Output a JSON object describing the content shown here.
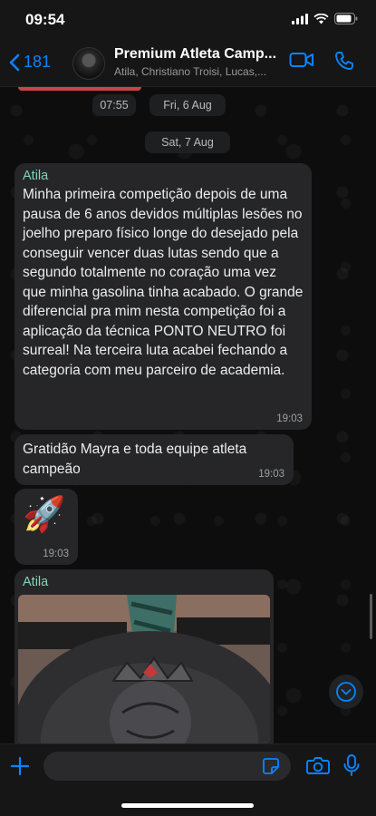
{
  "status_bar": {
    "time": "09:54"
  },
  "header": {
    "back_count": "181",
    "title": "Premium Atleta Camp...",
    "subtitle": "Atila, Christiano Troisi, Lucas,..."
  },
  "top_message": {
    "time": "07:55"
  },
  "date_separators": [
    "Fri, 6 Aug",
    "Sat, 7 Aug"
  ],
  "messages": [
    {
      "sender": "Atila",
      "text": "Minha primeira competição depois de uma pausa de 6 anos devidos múltiplas lesões no joelho preparo físico longe do desejado pela conseguir vencer duas lutas sendo que a segundo totalmente no coração uma vez que minha gasolina tinha acabado. O grande diferencial pra mim nesta competição foi a aplicação da técnica PONTO NEUTRO foi surreal! Na terceira luta acabei fechando a categoria com meu parceiro de academia.",
      "time": "19:03"
    },
    {
      "text": "Gratidão Mayra e toda equipe atleta campeão",
      "time": "19:03"
    },
    {
      "emoji": "🚀",
      "time": "19:03"
    },
    {
      "sender": "Atila",
      "type": "photo"
    }
  ],
  "icons": [
    "back-chevron-icon",
    "video-call-icon",
    "phone-icon",
    "scroll-down-icon",
    "plus-icon",
    "sticker-icon",
    "camera-icon",
    "microphone-icon",
    "signal-icon",
    "wifi-icon",
    "battery-icon"
  ],
  "colors": {
    "accent": "#0a84ff",
    "sender_name": "#7fd6b4",
    "bubble": "#262628",
    "background": "#0b0b0b"
  }
}
